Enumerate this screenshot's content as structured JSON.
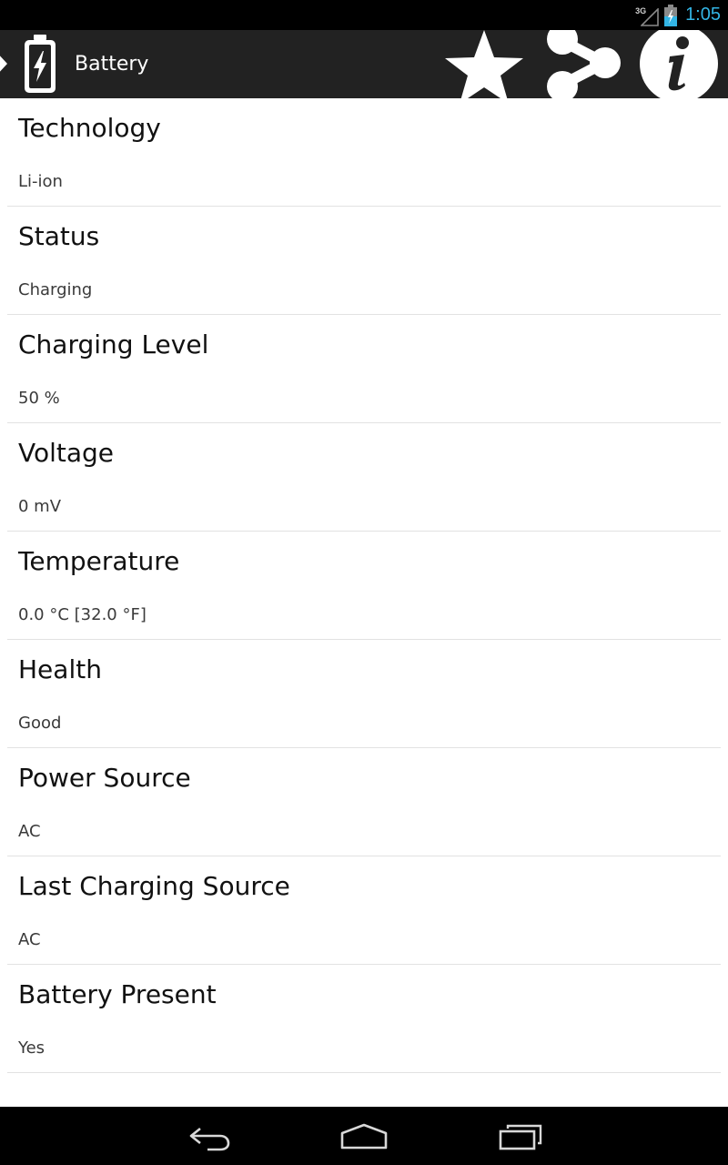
{
  "status_bar": {
    "network_label": "3G",
    "time": "1:05",
    "accent_color": "#33b5e5",
    "icons": [
      "signal-icon",
      "battery-charging-icon"
    ]
  },
  "action_bar": {
    "title": "Battery",
    "icons": [
      "up-caret-icon",
      "battery-app-icon",
      "star-icon",
      "share-icon",
      "info-icon"
    ]
  },
  "properties": [
    {
      "label": "Technology",
      "value": "Li-ion"
    },
    {
      "label": "Status",
      "value": "Charging"
    },
    {
      "label": "Charging Level",
      "value": "50 %"
    },
    {
      "label": "Voltage",
      "value": "0 mV"
    },
    {
      "label": "Temperature",
      "value": "0.0 °C [32.0 °F]"
    },
    {
      "label": "Health",
      "value": "Good"
    },
    {
      "label": "Power Source",
      "value": "AC"
    },
    {
      "label": "Last Charging Source",
      "value": "AC"
    },
    {
      "label": "Battery Present",
      "value": "Yes"
    }
  ],
  "nav_bar": {
    "icons": [
      "back-icon",
      "home-icon",
      "recent-apps-icon"
    ]
  }
}
